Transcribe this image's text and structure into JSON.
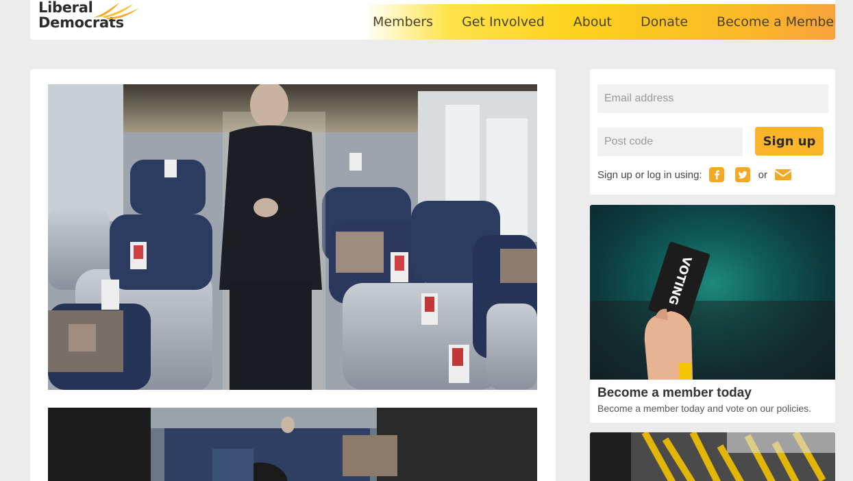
{
  "header": {
    "logo_line1": "Liberal",
    "logo_line2": "Democrats",
    "nav": [
      "Members",
      "Get Involved",
      "About",
      "Donate",
      "Become a Member"
    ]
  },
  "signup": {
    "email_placeholder": "Email address",
    "postcode_placeholder": "Post code",
    "button_label": "Sign up",
    "social_prompt": "Sign up or log in using:",
    "social_or": "or",
    "icons": [
      "facebook-icon",
      "twitter-icon",
      "email-icon"
    ]
  },
  "cards": [
    {
      "title": "Become a member today",
      "description": "Become a member today and vote on our policies.",
      "image_text": "VOTING"
    }
  ],
  "colors": {
    "brand_orange": "#fbb52a",
    "page_bg": "#ececec"
  }
}
